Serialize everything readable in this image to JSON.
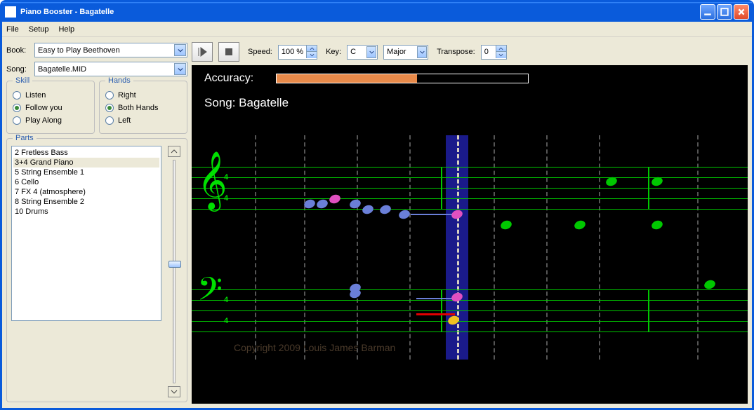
{
  "window": {
    "title": "Piano Booster - Bagatelle"
  },
  "menu": {
    "file": "File",
    "setup": "Setup",
    "help": "Help"
  },
  "left": {
    "book_label": "Book:",
    "book_value": "Easy to Play Beethoven",
    "song_label": "Song:",
    "song_value": "Bagatelle.MID",
    "skill_legend": "Skill",
    "skill": {
      "listen": "Listen",
      "follow": "Follow you",
      "play": "Play Along",
      "selected": "follow"
    },
    "hands_legend": "Hands",
    "hands": {
      "right": "Right",
      "both": "Both Hands",
      "left": "Left",
      "selected": "both"
    },
    "parts_legend": "Parts",
    "parts": [
      "2 Fretless Bass",
      "3+4 Grand Piano",
      "5 String Ensemble 1",
      "6 Cello",
      "7 FX 4 (atmosphere)",
      "8 String Ensemble 2",
      "10 Drums"
    ],
    "parts_selected_index": 1
  },
  "toolbar": {
    "speed_label": "Speed:",
    "speed_value": "100 %",
    "key_label": "Key:",
    "key_value": "C",
    "mode_value": "Major",
    "transpose_label": "Transpose:",
    "transpose_value": "0"
  },
  "canvas": {
    "accuracy_label": "Accuracy:",
    "accuracy_pct": 56,
    "song_label": "Song: Bagatelle",
    "time_sig_top": "4",
    "time_sig_bot": "4",
    "copyright": "Copyright 2009 Louis James Barman"
  }
}
